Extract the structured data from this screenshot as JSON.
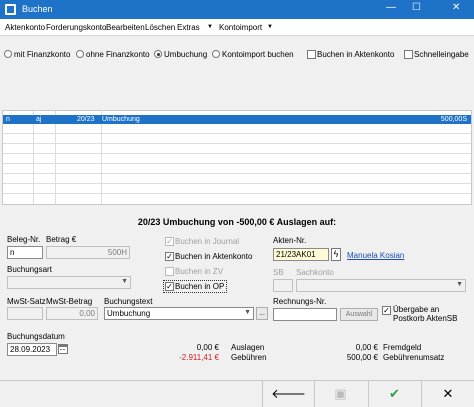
{
  "window": {
    "title": "Buchen",
    "minimize": "—",
    "maximize": "☐",
    "close": "✕"
  },
  "menu": [
    "Aktenkonto",
    "Forderungskonto",
    "Bearbeiten",
    "Löschen",
    "Extras",
    "Kontoimport"
  ],
  "options": {
    "radio_mit_finanzkonto": "mit Finanzkonto",
    "radio_ohne_finanzkonto": "ohne Finanzkonto",
    "radio_umbuchung": "Umbuchung",
    "radio_kontoimport": "Kontoimport buchen",
    "chk_buchen_aktenkonto": "Buchen in Aktenkonto",
    "chk_schnelleingabe": "Schnelleingabe"
  },
  "grid": {
    "rows": [
      {
        "c1": "n",
        "c2": "aj",
        "c3": "20/23",
        "c4": "Umbuchung",
        "c5": "500,00S"
      }
    ]
  },
  "form": {
    "heading": "20/23 Umbuchung von -500,00 € Auslagen  auf:",
    "beleg_nr_label": "Beleg-Nr.",
    "betrag_label": "Betrag €",
    "beleg_nr_value": "n",
    "betrag_value": "500H",
    "buchungsart_label": "Buchungsart",
    "buchungsart_value": "",
    "mwst_satz_label": "MwSt-Satz",
    "mwst_betrag_label": "MwSt-Betrag",
    "mwst_betrag_value": "0,00",
    "buchungstext_label": "Buchungstext",
    "buchungstext_value": "Umbuchung",
    "buchungsdatum_label": "Buchungsdatum",
    "buchungsdatum_value": "28.09.2023",
    "chk_buchen_journal": "Buchen in Journal",
    "chk_buchen_aktenkonto": "Buchen in Aktenkonto",
    "chk_buchen_zv": "Buchen in ZV",
    "chk_buchen_op": "Buchen in OP",
    "akten_nr_label": "Akten-Nr.",
    "akten_nr_value": "21/23AK01",
    "akten_person": "Manuela Kosian",
    "sb_label": "SB",
    "sachkonto_label": "Sachkonto",
    "rechnungs_nr_label": "Rechnungs-Nr.",
    "auswahl_label": "Auswahl",
    "uebergabe_label_1": "Übergabe an",
    "uebergabe_label_2": "Postkorb AktenSB",
    "ellipsis": "...",
    "summary": {
      "auslagen_value": "0,00 €",
      "auslagen_label": "Auslagen",
      "gebuehren_value": "-2.911,41 €",
      "gebuehren_label": "Gebühren",
      "fremdgeld_value": "0,00 €",
      "fremdgeld_label": "Fremdgeld",
      "gebuehrenumsatz_value": "500,00 €",
      "gebuehrenumsatz_label": "Gebührenumsatz"
    }
  },
  "footer": {
    "back": "🡐",
    "save": "▣",
    "ok": "✔",
    "cancel": "✕"
  },
  "colors": {
    "accent": "#1e73c8",
    "negative": "#d02020",
    "ok": "#2a9d4a"
  }
}
